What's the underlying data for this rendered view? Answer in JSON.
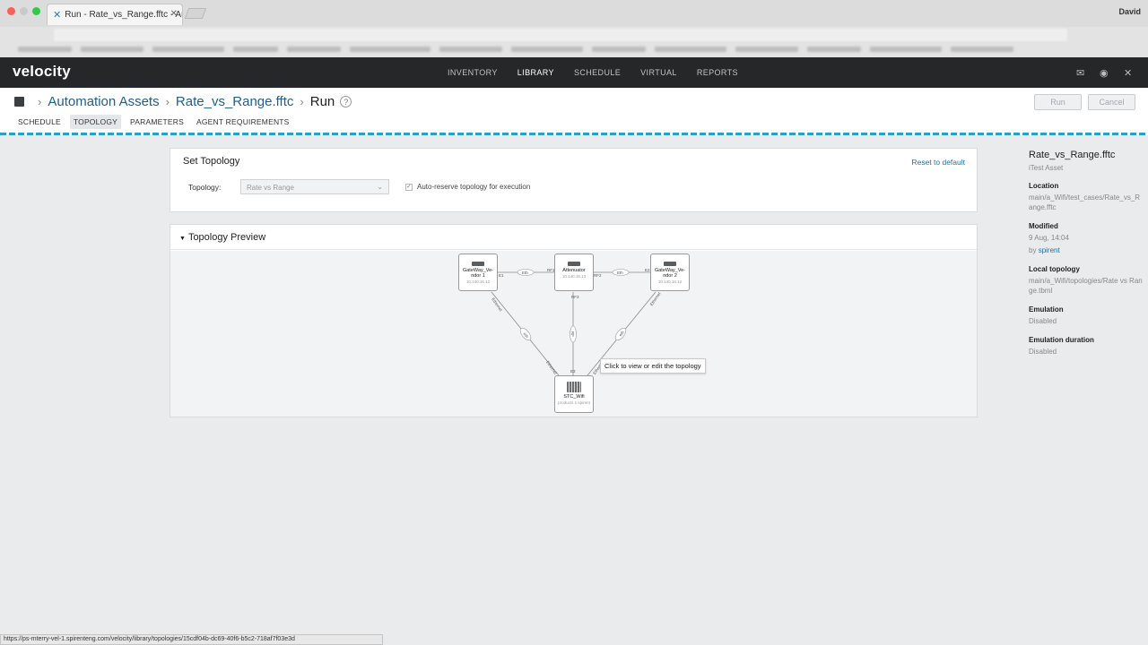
{
  "browser": {
    "tab_title": "Run - Rate_vs_Range.fftc - Au",
    "user": "David",
    "status_url": "https://ps-mterry-vel-1.spirenteng.com/velocity/library/topologies/15cdf04b-dc69-40f6-b5c2-718af7f03e3d"
  },
  "app": {
    "logo": "velocity",
    "nav": [
      "INVENTORY",
      "LIBRARY",
      "SCHEDULE",
      "VIRTUAL",
      "REPORTS"
    ]
  },
  "breadcrumb": {
    "items": [
      "Automation Assets",
      "Rate_vs_Range.fftc"
    ],
    "current": "Run",
    "help": "?"
  },
  "subtabs": [
    "SCHEDULE",
    "TOPOLOGY",
    "PARAMETERS",
    "AGENT REQUIREMENTS"
  ],
  "actions": {
    "run": "Run",
    "cancel": "Cancel"
  },
  "set_topology": {
    "title": "Set Topology",
    "reset": "Reset to default",
    "label": "Topology:",
    "selected": "Rate vs Range",
    "autoreserve": "Auto-reserve topology for execution"
  },
  "preview": {
    "title": "Topology Preview",
    "tooltip": "Click to view or edit the topology",
    "nodes": {
      "gw1": {
        "name": "GateWay_Ve- ndor 1",
        "ip": "10.140.16.12"
      },
      "att": {
        "name": "Attenuator",
        "ip": "10.140.16.13"
      },
      "gw2": {
        "name": "GateWay_Ve- ndor 2",
        "ip": "10.140.16.12"
      },
      "stc": {
        "name": "STC_Wifi",
        "ip": "products 1 spirent"
      }
    },
    "link_labels": {
      "eth": "Eth",
      "eth_small": "eth",
      "ethernet": "Ethernet",
      "rf1": "RF1",
      "rf2": "RF2",
      "rf3": "RF3",
      "rf": "RF",
      "e1": "E1",
      "e2": "E2",
      "e3": "E3"
    }
  },
  "info": {
    "title": "Rate_vs_Range.fftc",
    "subtitle": "iTest Asset",
    "location_label": "Location",
    "location": "main/a_Wifi/test_cases/Rate_vs_Range.fftc",
    "modified_label": "Modified",
    "modified": "9 Aug, 14:04",
    "by_prefix": "by",
    "by": "spirent",
    "local_topology_label": "Local topology",
    "local_topology": "main/a_Wifi/topologies/Rate vs Range.tbml",
    "emulation_label": "Emulation",
    "emulation": "Disabled",
    "emulation_duration_label": "Emulation duration",
    "emulation_duration": "Disabled"
  },
  "colors": {
    "header_bg": "#252729",
    "link": "#1f6fa8",
    "accent": "#2a9fc8"
  }
}
